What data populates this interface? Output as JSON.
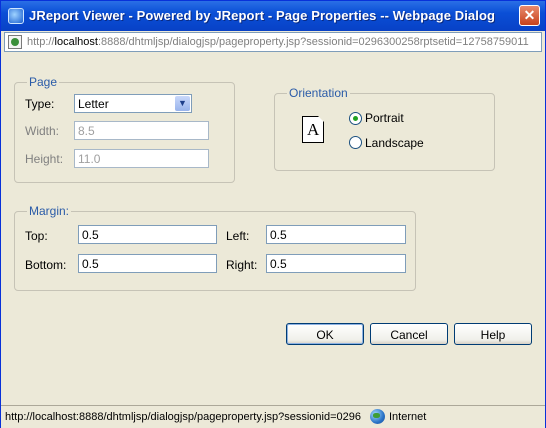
{
  "window": {
    "title": "JReport Viewer - Powered by JReport - Page Properties -- Webpage Dialog",
    "close_glyph": "✕"
  },
  "address": {
    "prefix": "http://",
    "host": "localhost",
    "rest": ":8888/dhtmljsp/dialogjsp/pageproperty.jsp?sessionid=0296300258rptsetid=12758759011"
  },
  "page": {
    "legend": "Page",
    "type_label": "Type:",
    "type_value": "Letter",
    "width_label": "Width:",
    "width_value": "8.5",
    "height_label": "Height:",
    "height_value": "11.0"
  },
  "orientation": {
    "legend": "Orientation",
    "icon_letter": "A",
    "portrait_label": "Portrait",
    "landscape_label": "Landscape",
    "selected": "Portrait"
  },
  "margin": {
    "legend": "Margin:",
    "top_label": "Top:",
    "top_value": "0.5",
    "left_label": "Left:",
    "left_value": "0.5",
    "bottom_label": "Bottom:",
    "bottom_value": "0.5",
    "right_label": "Right:",
    "right_value": "0.5"
  },
  "buttons": {
    "ok": "OK",
    "cancel": "Cancel",
    "help": "Help"
  },
  "status": {
    "url": "http://localhost:8888/dhtmljsp/dialogjsp/pageproperty.jsp?sessionid=0296",
    "zone": "Internet"
  }
}
